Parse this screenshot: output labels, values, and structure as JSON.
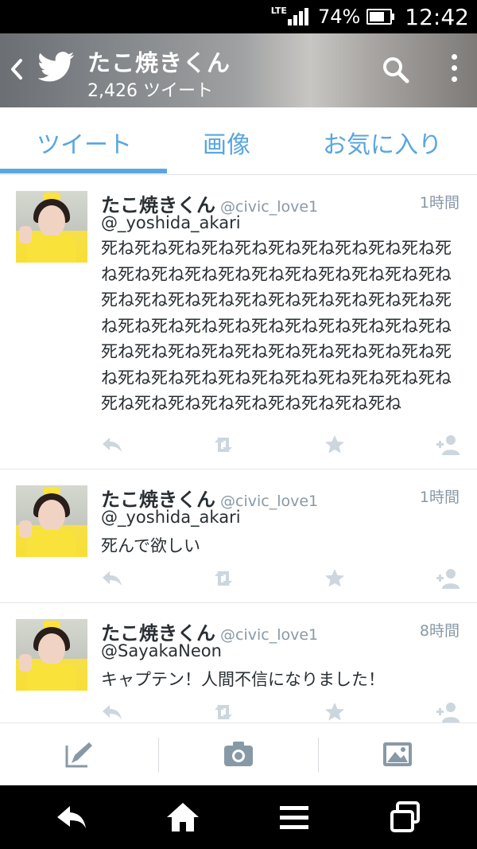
{
  "status_bar": {
    "network": "LTE",
    "battery_percent": "74%",
    "battery_level": 0.74,
    "time": "12:42"
  },
  "header": {
    "title": "たこ焼きくん",
    "subtitle": "2,426 ツイート",
    "icons": [
      "back-icon",
      "twitter-bird-icon",
      "search-icon",
      "more-vert-icon"
    ]
  },
  "tabs": [
    {
      "label": "ツイート",
      "active": true
    },
    {
      "label": "画像",
      "active": false
    },
    {
      "label": "お気に入り",
      "active": false
    }
  ],
  "tweets": [
    {
      "name": "たこ焼きくん",
      "handle": "@civic_love1",
      "time": "1時間",
      "reply_to": "@_yoshida_akari",
      "text": "死ね死ね死ね死ね死ね死ね死ね死ね死ね死ね死ね死ね死ね死ね死ね死ね死ね死ね死ね死ね死ね死ね死ね死ね死ね死ね死ね死ね死ね死ね死ね死ね死ね死ね死ね死ね死ね死ね死ね死ね死ね死ね死ね死ね死ね死ね死ね死ね死ね死ね死ね死ね死ね死ね死ね死ね死ね死ね死ね死ね死ね死ね死ね死ね死ね死ね死ね死ね死ね死ね死ね死ね"
    },
    {
      "name": "たこ焼きくん",
      "handle": "@civic_love1",
      "time": "1時間",
      "reply_to": "@_yoshida_akari",
      "text": "死んで欲しい"
    },
    {
      "name": "たこ焼きくん",
      "handle": "@civic_love1",
      "time": "8時間",
      "reply_to": "@SayakaNeon",
      "text": "キャプテン！人間不信になりました！"
    }
  ],
  "tweet_actions": [
    "reply-icon",
    "retweet-icon",
    "favorite-icon",
    "follow-icon"
  ],
  "compose_bar": [
    "compose-icon",
    "camera-icon",
    "image-icon"
  ],
  "nav_bar": [
    "nav-back-icon",
    "nav-home-icon",
    "nav-menu-icon",
    "nav-recents-icon"
  ],
  "colors": {
    "accent": "#55acee",
    "text": "#292f33",
    "muted": "#8899a6",
    "icon": "#ccd6dd"
  }
}
